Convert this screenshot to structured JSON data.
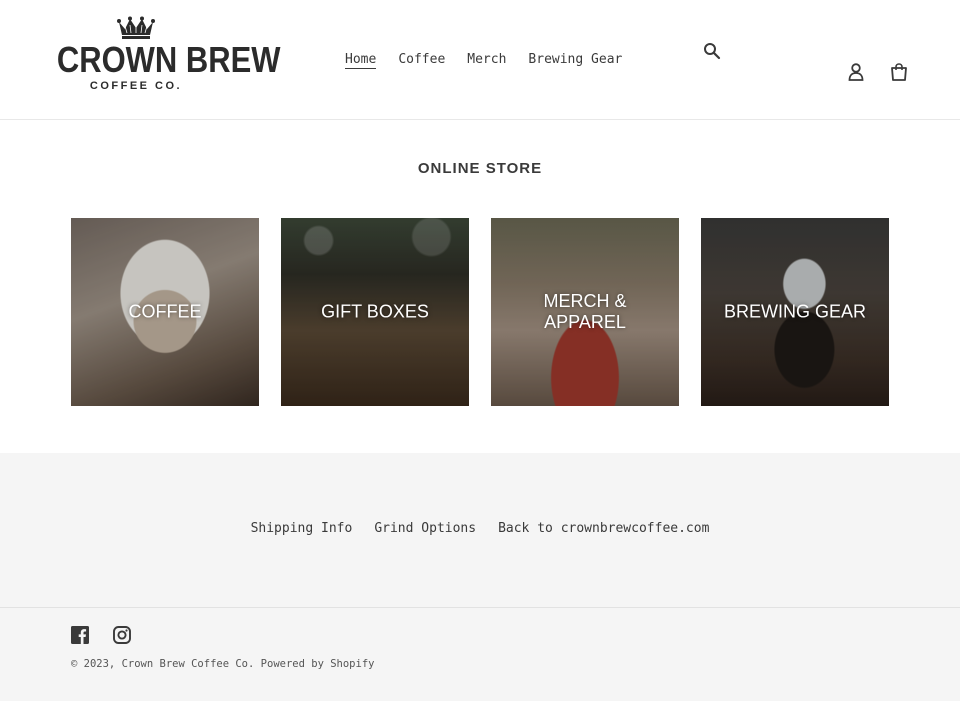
{
  "header": {
    "logo": {
      "name": "CROWN BREW",
      "tagline": "COFFEE CO.",
      "icon": "crown-icon"
    },
    "nav": [
      {
        "label": "Home",
        "active": true
      },
      {
        "label": "Coffee",
        "active": false
      },
      {
        "label": "Merch",
        "active": false
      },
      {
        "label": "Brewing Gear",
        "active": false
      }
    ],
    "icons": {
      "search": "search-icon",
      "account": "user-icon",
      "cart": "cart-icon"
    }
  },
  "main": {
    "section_title": "ONLINE STORE",
    "collections": [
      {
        "title": "COFFEE"
      },
      {
        "title": "GIFT BOXES"
      },
      {
        "title": "MERCH & APPAREL"
      },
      {
        "title": "BREWING GEAR"
      }
    ]
  },
  "footer": {
    "links": [
      {
        "label": "Shipping Info"
      },
      {
        "label": "Grind Options"
      },
      {
        "label": "Back to crownbrewcoffee.com"
      }
    ],
    "social": [
      "facebook-icon",
      "instagram-icon"
    ],
    "copyright_prefix": "© 2023, ",
    "copyright_brand": "Crown Brew Coffee Co.",
    "powered_by": "Powered by Shopify"
  },
  "colors": {
    "text": "#3a3a3a",
    "footer_bg": "#f5f5f5",
    "border": "#e8e8e8",
    "card_text": "#ffffff"
  }
}
